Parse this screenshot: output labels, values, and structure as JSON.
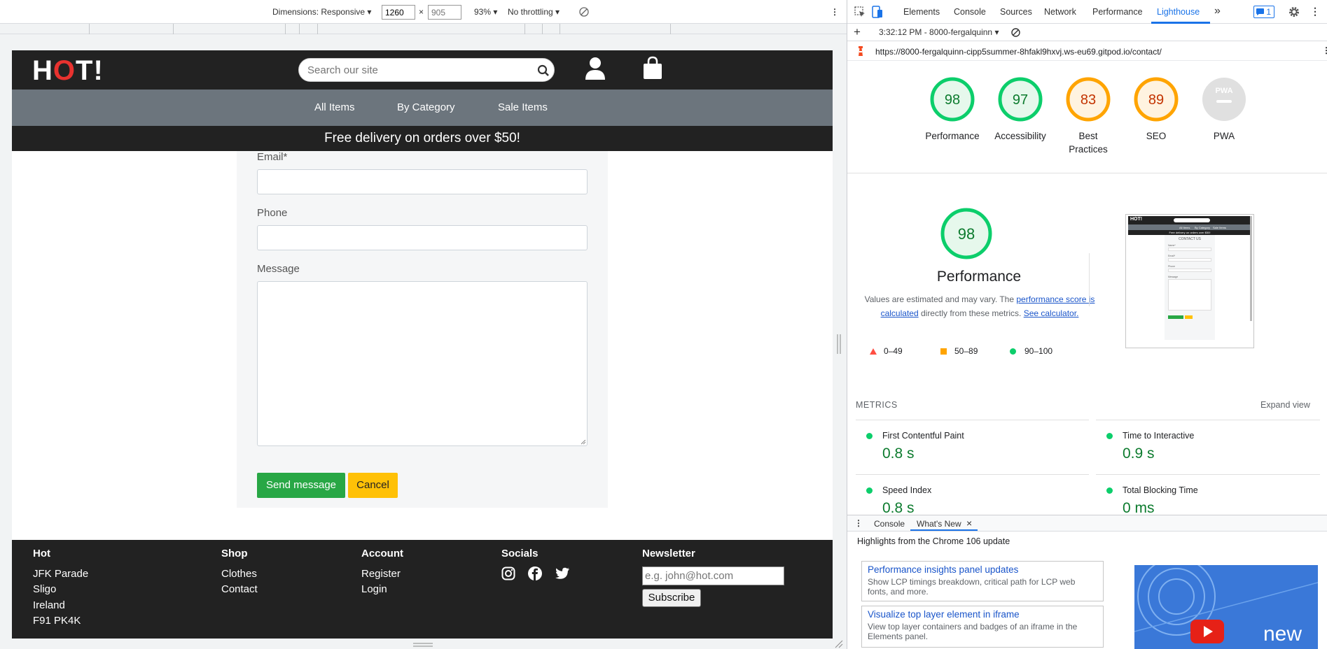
{
  "device_toolbar": {
    "dimensions_label": "Dimensions: Responsive",
    "width_value": "1260",
    "height_placeholder": "905",
    "times": "×",
    "zoom": "93%",
    "throttling": "No throttling"
  },
  "site": {
    "logo": {
      "pre": "H",
      "flame": "O",
      "post": "T!"
    },
    "search_placeholder": "Search our site",
    "nav": [
      "All Items",
      "By Category",
      "Sale Items"
    ],
    "promo": "Free delivery on orders over $50!",
    "form": {
      "email_label": "Email*",
      "phone_label": "Phone",
      "message_label": "Message",
      "send_label": "Send message",
      "cancel_label": "Cancel"
    },
    "footer": {
      "hot": {
        "heading": "Hot",
        "lines": [
          "JFK Parade",
          "Sligo",
          "Ireland",
          "F91 PK4K"
        ]
      },
      "shop": {
        "heading": "Shop",
        "items": [
          "Clothes",
          "Contact"
        ]
      },
      "account": {
        "heading": "Account",
        "items": [
          "Register",
          "Login"
        ]
      },
      "socials": {
        "heading": "Socials",
        "icons": [
          "instagram-icon",
          "facebook-icon",
          "twitter-icon"
        ]
      },
      "newsletter": {
        "heading": "Newsletter",
        "placeholder": "e.g. john@hot.com",
        "button": "Subscribe"
      }
    }
  },
  "devtools": {
    "tabs": [
      "Elements",
      "Console",
      "Sources",
      "Network",
      "Performance",
      "Lighthouse"
    ],
    "active_tab": "Lighthouse",
    "more_tabs": "»",
    "issues_count": "1",
    "report_label": "3:32:12 PM - 8000-fergalquinn",
    "url": "https://8000-fergalquinn-cipp5summer-8hfakl9hxvj.ws-eu69.gitpod.io/contact/",
    "scores": [
      {
        "label": "Performance",
        "score": "98",
        "status": "pass"
      },
      {
        "label": "Accessibility",
        "score": "97",
        "status": "pass"
      },
      {
        "label": "Best Practices",
        "score": "83",
        "status": "average"
      },
      {
        "label": "SEO",
        "score": "89",
        "status": "average"
      },
      {
        "label": "PWA",
        "score": "",
        "status": "na"
      }
    ],
    "pwa_badge": "PWA",
    "performance": {
      "score": "98",
      "title": "Performance",
      "desc_pre": "Values are estimated and may vary. The ",
      "desc_link1": "performance score is calculated",
      "desc_mid": " directly from these metrics. ",
      "desc_link2": "See calculator.",
      "legend": [
        "0–49",
        "50–89",
        "90–100"
      ]
    },
    "metrics_header": "METRICS",
    "expand_view": "Expand view",
    "metrics": [
      {
        "name": "First Contentful Paint",
        "value": "0.8 s"
      },
      {
        "name": "Time to Interactive",
        "value": "0.9 s"
      },
      {
        "name": "Speed Index",
        "value": "0.8 s"
      },
      {
        "name": "Total Blocking Time",
        "value": "0 ms"
      }
    ],
    "drawer": {
      "tabs": [
        "Console",
        "What's New"
      ],
      "close": "×",
      "highlights": "Highlights from the Chrome 106 update",
      "cards": [
        {
          "title": "Performance insights panel updates",
          "body": "Show LCP timings breakdown, critical path for LCP web fonts, and more."
        },
        {
          "title": "Visualize top layer element in iframe",
          "body": "View top layer containers and badges of an iframe in the Elements panel."
        }
      ],
      "video_label": "new"
    },
    "thumbnail": {
      "logo": "HOT!",
      "promo": "Free delivery on orders over $50!",
      "heading": "CONTACT US",
      "nav": [
        "All Items",
        "By Category",
        "Sale Items"
      ],
      "fields": [
        "Name*",
        "Email*",
        "Phone",
        "Message"
      ]
    },
    "colors": {
      "pass": "#0cce6b",
      "average": "#ffa400",
      "fail": "#ff4e42",
      "na": "#9e9e9e"
    }
  }
}
